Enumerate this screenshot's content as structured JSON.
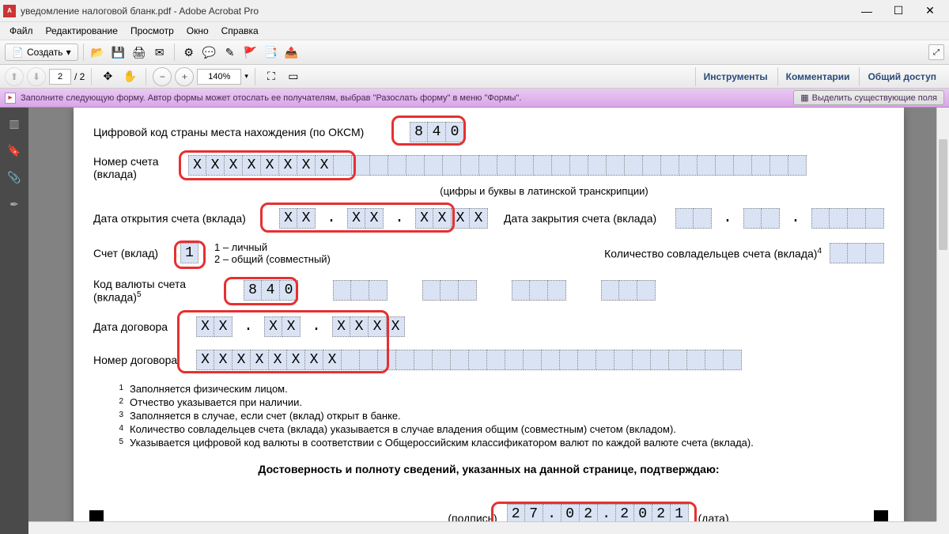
{
  "window": {
    "title": "уведомление налоговой бланк.pdf - Adobe Acrobat Pro",
    "min": "—",
    "max": "☐",
    "close": "✕"
  },
  "menu": {
    "file": "Файл",
    "edit": "Редактирование",
    "view": "Просмотр",
    "window": "Окно",
    "help": "Справка"
  },
  "toolbar": {
    "create": "Создать"
  },
  "nav": {
    "page": "2",
    "pages": "/ 2",
    "zoom": "140%"
  },
  "panels": {
    "tools": "Инструменты",
    "comments": "Комментарии",
    "share": "Общий доступ"
  },
  "formbar": {
    "msg": "Заполните следующую форму. Автор формы может отослать ее получателям, выбрав \"Разослать форму\" в меню \"Формы\".",
    "highlight": "Выделить существующие поля"
  },
  "doc": {
    "country_label": "Цифровой код страны места нахождения (по ОКСМ)",
    "country_code": "840",
    "acct_label": "Номер счета (вклада)",
    "acct": "XXXXXXXX",
    "acct_hint": "(цифры и буквы в латинской транскрипции)",
    "open_label": "Дата открытия счета (вклада)",
    "open_d": "XX",
    "open_m": "XX",
    "open_y": "XXXX",
    "close_label": "Дата закрытия счета (вклада)",
    "close_d": "",
    "close_m": "",
    "close_y": "",
    "type_label": "Счет (вклад)",
    "type_val": "1",
    "type_hint1": "1 – личный",
    "type_hint2": "2 – общий (совместный)",
    "coowners_label": "Количество совладельцев счета (вклада)",
    "coowners": "",
    "cur_label": "Код валюты счета (вклада)",
    "cur1": "840",
    "cur2": "",
    "cur3": "",
    "cur4": "",
    "cur5": "",
    "contract_date_label": "Дата договора",
    "cd_d": "XX",
    "cd_m": "XX",
    "cd_y": "XXXX",
    "contract_num_label": "Номер договора",
    "contract_num": "XXXXXXXX",
    "fn1": "Заполняется физическим лицом.",
    "fn2": "Отчество указывается при наличии.",
    "fn3": "Заполняется в случае, если счет (вклад) открыт в банке.",
    "fn4": "Количество совладельцев счета (вклада) указывается в случае владения общим (совместным) счетом (вкладом).",
    "fn5": "Указывается цифровой код валюты в соответствии с Общероссийским классификатором валют по каждой валюте счета (вклада).",
    "confirm": "Достоверность и полноту сведений, указанных на данной странице, подтверждаю:",
    "sign_lbl": "(подпись)",
    "date_lbl": "(дата)",
    "conf_date": "27.02.2021"
  }
}
